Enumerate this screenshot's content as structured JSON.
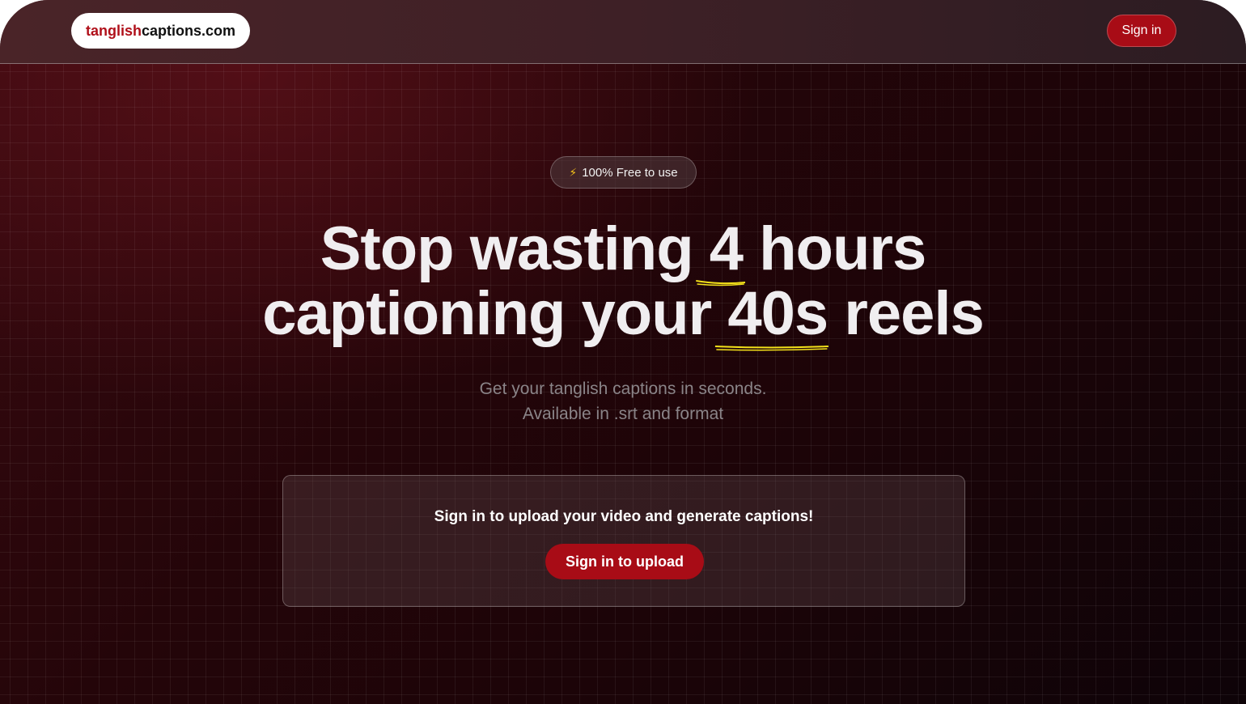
{
  "header": {
    "logo_accent": "tanglish",
    "logo_rest": "captions.com",
    "signin_label": "Sign in"
  },
  "hero": {
    "badge_icon": "lightning-bolt-icon",
    "badge_text": "100% Free to use",
    "headline_line1_pre": "Stop wasting ",
    "headline_line1_highlight": "4",
    "headline_line1_post": " hours",
    "headline_line2_pre": "captioning your ",
    "headline_line2_highlight": "40s",
    "headline_line2_post": " reels",
    "subtitle_line1": "Get your tanglish captions in seconds.",
    "subtitle_line2": "Available in .srt and format"
  },
  "upload_card": {
    "message": "Sign in to upload your video and generate captions!",
    "button_label": "Sign in to upload"
  },
  "colors": {
    "accent": "#a80c16",
    "underline": "#f4e21a"
  }
}
